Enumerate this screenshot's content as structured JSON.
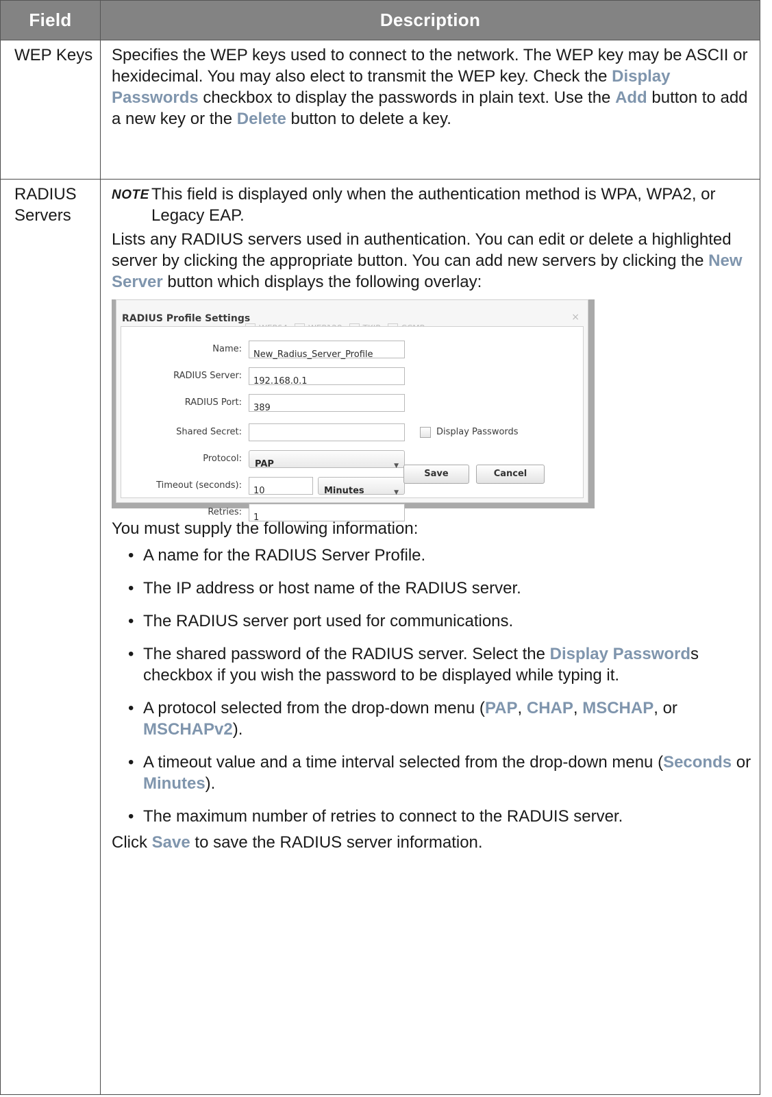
{
  "header": {
    "field": "Field",
    "description": "Description"
  },
  "wep": {
    "field": "WEP Keys",
    "t1": "Specifies the WEP keys used to connect to the network. The WEP key may be ASCII or hexidecimal. You may also elect to transmit the WEP key. Check the ",
    "h1": "Display Passwords",
    "t2": " checkbox to display the passwords in plain text. Use the ",
    "h2": "Add",
    "t3": " button to add a new key or the ",
    "h3": "Delete",
    "t4": " button to delete a key."
  },
  "radius": {
    "field": "RADIUS Servers",
    "note_tag": "NOTE",
    "note_text": "This field is displayed only when the authentication method is WPA, WPA2, or Legacy EAP.",
    "p1": "Lists any RADIUS servers used in authentication. You can edit or delete a highlighted server by clicking the appropriate button. You can add new servers by clicking the ",
    "p1_hl": "New Server",
    "p1_end": " button which displays the following overlay:",
    "supply": "You must supply the following information:",
    "b1": "A name for the RADIUS Server Profile.",
    "b2": "The IP address or host name of the RADIUS server.",
    "b3": "The RADIUS server port used for communications.",
    "b4a": "The shared password of the RADIUS server. Select the ",
    "b4h": "Display Password",
    "b4b": "s checkbox if you wish the password to be displayed while typing it.",
    "b5a": "A protocol selected from the drop-down menu (",
    "b5h1": "PAP",
    "b5s1": ", ",
    "b5h2": "CHAP",
    "b5s2": ", ",
    "b5h3": "MSCHAP",
    "b5s3": ", or ",
    "b5h4": "MSCHAPv2",
    "b5e": ").",
    "b6a": "A timeout value and a time interval selected from the drop-down menu (",
    "b6h1": "Seconds",
    "b6s": " or ",
    "b6h2": "Minutes",
    "b6e": ").",
    "b7": "The maximum number of retries to connect to the RADUIS server.",
    "final_a": "Click ",
    "final_h": "Save",
    "final_b": " to save the RADIUS server information."
  },
  "dialog": {
    "title": "RADIUS Profile Settings",
    "close": "×",
    "bleed": [
      "WEP64",
      "WEP128",
      "TKIP",
      "CCMP"
    ],
    "name_label": "Name:",
    "name_value": "New_Radius_Server_Profile",
    "server_label": "RADIUS Server:",
    "server_value": "192.168.0.1",
    "port_label": "RADIUS Port:",
    "port_value": "389",
    "secret_label": "Shared Secret:",
    "secret_value": "",
    "display_pw_label": "Display Passwords",
    "protocol_label": "Protocol:",
    "protocol_value": "PAP",
    "timeout_label": "Timeout (seconds):",
    "timeout_value": "10",
    "timeout_unit": "Minutes",
    "retries_label": "Retries:",
    "retries_value": "1",
    "save": "Save",
    "cancel": "Cancel"
  },
  "colors": {
    "header_bg": "#838383",
    "highlight": "#7f95ad"
  }
}
